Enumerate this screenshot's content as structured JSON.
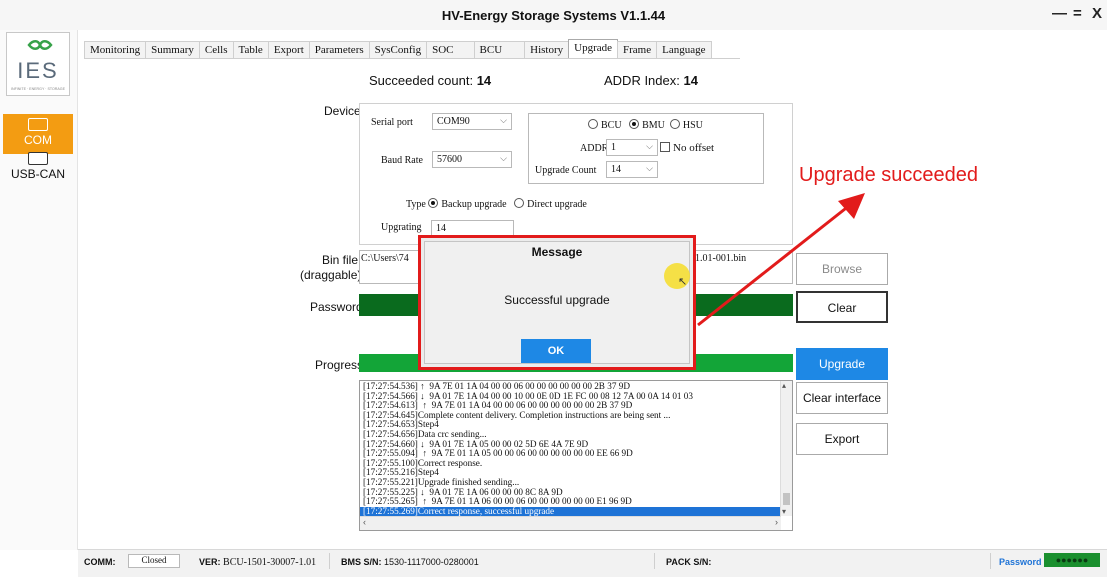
{
  "window": {
    "title": "HV-Energy Storage Systems V1.1.44",
    "minimize": "—",
    "maximize": "=",
    "close": "X"
  },
  "sidebar": {
    "logo_text": "IES",
    "logo_caption": "INFINITE · ENERGY · STORAGE",
    "items": [
      {
        "label": "COM",
        "active": true
      },
      {
        "label": "USB-CAN",
        "active": false
      }
    ],
    "active_color": "#f39c12"
  },
  "tabs": [
    "Monitoring",
    "Summary",
    "Cells",
    "Table",
    "Export",
    "Parameters",
    "SysConfig",
    "SOC",
    "BCU",
    "History",
    "Upgrade",
    "Frame",
    "Language"
  ],
  "active_tab": "Upgrade",
  "counts": {
    "succeeded_label": "Succeeded count:",
    "succeeded_value": "14",
    "addr_label": "ADDR Index:",
    "addr_value": "14"
  },
  "device": {
    "label": "Device",
    "serial_port_label": "Serial port",
    "serial_port_value": "COM90",
    "baud_rate_label": "Baud Rate",
    "baud_rate_value": "57600",
    "targets": [
      "BCU",
      "BMU",
      "HSU"
    ],
    "selected_target": "BMU",
    "addr_label": "ADDR",
    "addr_value": "1",
    "no_offset_label": "No offset",
    "upgrade_count_label": "Upgrade Count",
    "upgrade_count_value": "14",
    "type_label": "Type",
    "type_options": [
      "Backup upgrade",
      "Direct upgrade"
    ],
    "selected_type": "Backup upgrade",
    "upgrating_label": "Upgrating",
    "upgrating_value": "14"
  },
  "bin_file": {
    "label_line1": "Bin file",
    "label_line2": "(draggable)",
    "path_start": "C:\\Users\\74",
    "path_end": "1.01-001.bin"
  },
  "password_label": "Password",
  "progress": {
    "label": "Progress",
    "value": 1.0,
    "color": "#13a538"
  },
  "password_bar_color": "#0a6b1e",
  "buttons": {
    "browse": "Browse",
    "clear": "Clear",
    "upgrade": "Upgrade",
    "clear_interface": "Clear interface",
    "export": "Export"
  },
  "log_lines": [
    "[17:27:54.536] ↑  9A 7E 01 1A 04 00 00 06 00 00 00 00 00 00 2B 37 9D",
    "[17:27:54.566] ↓  9A 01 7E 1A 04 00 00 10 00 0E 0D 1E FC 00 08 12 7A 00 0A 14 01 03",
    "[17:27:54.613]  ↑  9A 7E 01 1A 04 00 00 06 00 00 00 00 00 00 2B 37 9D",
    "[17:27:54.645]Complete content delivery. Completion instructions are being sent ...",
    "[17:27:54.653]Step4",
    "[17:27:54.656]Data crc sending...",
    "[17:27:54.660] ↓  9A 01 7E 1A 05 00 00 02 5D 6E 4A 7E 9D",
    "[17:27:55.094]  ↑  9A 7E 01 1A 05 00 00 06 00 00 00 00 00 00 EE 66 9D",
    "[17:27:55.100]Correct response.",
    "[17:27:55.216]Step4",
    "[17:27:55.221]Upgrade finished sending...",
    "[17:27:55.225] ↓  9A 01 7E 1A 06 00 00 00 8C 8A 9D",
    "[17:27:55.265]  ↑  9A 7E 01 1A 06 00 00 06 00 00 00 00 00 00 E1 96 9D",
    "[17:27:55.269]Correct response, successful upgrade"
  ],
  "selected_log_index": 13,
  "dialog": {
    "title": "Message",
    "message": "Successful upgrade",
    "ok": "OK",
    "border_color": "#e21b1b",
    "ok_color": "#1e88e5"
  },
  "annotation": {
    "text": "Upgrade succeeded",
    "color": "#e21b1b"
  },
  "statusbar": {
    "comm_label": "COMM:",
    "comm_value": "Closed",
    "ver_label": "VER:",
    "ver_value": "BCU-1501-30007-1.01",
    "bms_label": "BMS S/N:",
    "bms_value": "1530-1117000-0280001",
    "pack_label": "PACK S/N:",
    "pack_value": "",
    "password_label": "Password",
    "password_dots": "●●●●●●",
    "password_color": "#1a8f2e"
  }
}
